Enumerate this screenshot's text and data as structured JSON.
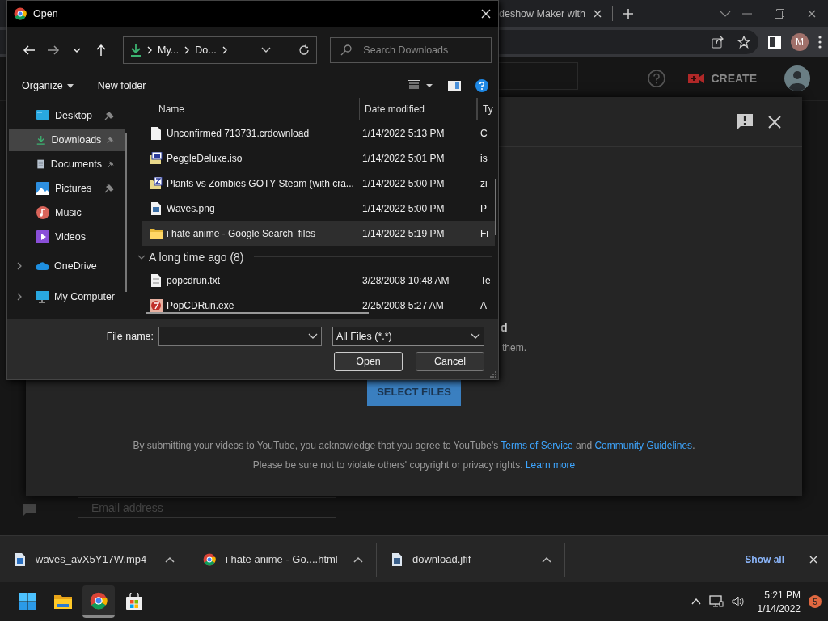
{
  "browser": {
    "tab": {
      "title": "deshow Maker with",
      "selected": false
    },
    "profile_initial": "M"
  },
  "youtube": {
    "create_label": "CREATE",
    "email_placeholder": "Email address",
    "upload": {
      "heading_fragment": "d",
      "text_fragment": "them.",
      "select_button": "SELECT FILES",
      "terms": [
        {
          "kind": "text",
          "text": "By submitting your videos to YouTube, you acknowledge that you agree to YouTube's "
        },
        {
          "kind": "link",
          "text": "Terms of Service"
        },
        {
          "kind": "text",
          "text": " and "
        },
        {
          "kind": "link",
          "text": "Community Guidelines"
        },
        {
          "kind": "text",
          "text": "."
        }
      ],
      "notice": [
        {
          "kind": "text",
          "text": "Please be sure not to violate others' copyright or privacy rights. "
        },
        {
          "kind": "link",
          "text": "Learn more"
        }
      ]
    }
  },
  "dialog": {
    "title": "Open",
    "breadcrumb": [
      "My...",
      "Do..."
    ],
    "search_placeholder": "Search Downloads",
    "organize": "Organize",
    "new_folder": "New folder",
    "quick_access": [
      {
        "label": "Desktop",
        "kind": "desktop",
        "pinned": true,
        "selected": false
      },
      {
        "label": "Downloads",
        "kind": "downloads",
        "pinned": true,
        "selected": true
      },
      {
        "label": "Documents",
        "kind": "documents",
        "pinned": true,
        "selected": false
      },
      {
        "label": "Pictures",
        "kind": "pictures",
        "pinned": true,
        "selected": false
      },
      {
        "label": "Music",
        "kind": "music",
        "pinned": false,
        "selected": false
      },
      {
        "label": "Videos",
        "kind": "videos",
        "pinned": false,
        "selected": false
      }
    ],
    "locations": [
      {
        "label": "OneDrive",
        "kind": "cloud",
        "expanded": false,
        "selected": false
      },
      {
        "label": "My Computer",
        "kind": "computer",
        "expanded": false,
        "selected": false
      }
    ],
    "columns": [
      "Name",
      "Date modified",
      "Ty"
    ],
    "groups": [
      {
        "rows": [
          {
            "name": "Unconfirmed 713731.crdownload",
            "date": "1/14/2022 5:13 PM",
            "type": "C",
            "kind": "file",
            "selected": false
          },
          {
            "name": "PeggleDeluxe.iso",
            "date": "1/14/2022 5:01 PM",
            "type": "is",
            "kind": "iso",
            "selected": false
          },
          {
            "name": "Plants vs Zombies GOTY Steam (with cra...",
            "date": "1/14/2022 5:00 PM",
            "type": "zi",
            "kind": "zip",
            "selected": false
          },
          {
            "name": "Waves.png",
            "date": "1/14/2022 5:00 PM",
            "type": "P",
            "kind": "image",
            "selected": false
          },
          {
            "name": "i hate anime - Google Search_files",
            "date": "1/14/2022 5:19 PM",
            "type": "Fi",
            "kind": "folder",
            "selected": true
          }
        ]
      },
      {
        "label": "A long time ago (8)",
        "expanded": true,
        "rows": [
          {
            "name": "popcdrun.txt",
            "date": "3/28/2008 10:48 AM",
            "type": "Te",
            "kind": "text",
            "selected": false
          },
          {
            "name": "PopCDRun.exe",
            "date": "2/25/2008 5:27 AM",
            "type": "A",
            "kind": "exe",
            "selected": false
          }
        ]
      }
    ],
    "file_name_label": "File name:",
    "filter": "All Files (*.*)",
    "buttons": [
      "Open",
      "Cancel"
    ]
  },
  "downloads": {
    "items": [
      {
        "name": "waves_avX5Y17W.mp4",
        "kind": "video"
      },
      {
        "name": "i hate anime - Go....html",
        "kind": "web"
      },
      {
        "name": "download.jfif",
        "kind": "image"
      }
    ],
    "show_all": "Show all"
  },
  "taskbar": {
    "apps": [
      {
        "kind": "start",
        "selected": false
      },
      {
        "kind": "explorer",
        "selected": false
      },
      {
        "kind": "chrome",
        "selected": true
      },
      {
        "kind": "store",
        "selected": false
      }
    ],
    "time": "5:21 PM",
    "date": "1/14/2022",
    "notification_count": "5"
  }
}
